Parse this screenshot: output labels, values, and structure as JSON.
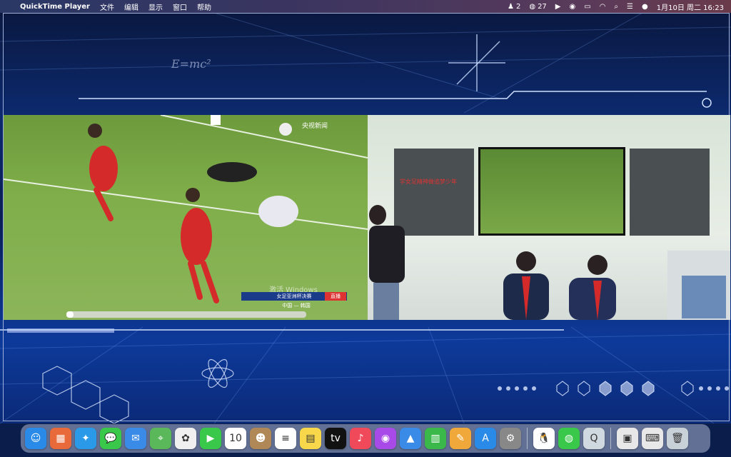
{
  "menubar": {
    "app_name": "QuickTime Player",
    "menus": [
      "文件",
      "编辑",
      "显示",
      "窗口",
      "帮助"
    ],
    "status": {
      "notifications_count": "2",
      "wechat_count": "27",
      "date_time": "1月10日 周二 16:23"
    }
  },
  "video": {
    "broadcaster_logo": "央视新闻",
    "watermark": "激活 Windows",
    "caption_title": "女足亚洲杯决赛",
    "caption_badge": "直播",
    "caption_sub": "中国 — 韩国",
    "progress_fraction": 0.03
  },
  "slide": {
    "formula": "E=mc²",
    "chalk_text": "学女足精神做追梦少年"
  },
  "dock": {
    "apps": [
      {
        "name": "finder",
        "glyph": "☺",
        "color": "#2a8ae8"
      },
      {
        "name": "launchpad",
        "glyph": "▦",
        "color": "#e86a3a"
      },
      {
        "name": "safari",
        "glyph": "✦",
        "color": "#2a9ae8"
      },
      {
        "name": "messages",
        "glyph": "💬",
        "color": "#3ac84a"
      },
      {
        "name": "mail",
        "glyph": "✉",
        "color": "#3a8ae8"
      },
      {
        "name": "maps",
        "glyph": "⌖",
        "color": "#5ab85a"
      },
      {
        "name": "photos",
        "glyph": "✿",
        "color": "#f0f0f0"
      },
      {
        "name": "facetime",
        "glyph": "▶",
        "color": "#3ac84a"
      },
      {
        "name": "calendar",
        "glyph": "10",
        "color": "#ffffff"
      },
      {
        "name": "contacts",
        "glyph": "☻",
        "color": "#b08858"
      },
      {
        "name": "reminders",
        "glyph": "≡",
        "color": "#ffffff"
      },
      {
        "name": "notes",
        "glyph": "▤",
        "color": "#f8d84a"
      },
      {
        "name": "apple-tv",
        "glyph": "tv",
        "color": "#111111"
      },
      {
        "name": "music",
        "glyph": "♪",
        "color": "#f04a5a"
      },
      {
        "name": "podcasts",
        "glyph": "◉",
        "color": "#a84ae8"
      },
      {
        "name": "keynote",
        "glyph": "▲",
        "color": "#3a8ae8"
      },
      {
        "name": "numbers",
        "glyph": "▥",
        "color": "#3ab84a"
      },
      {
        "name": "pages",
        "glyph": "✎",
        "color": "#f0a83a"
      },
      {
        "name": "app-store",
        "glyph": "A",
        "color": "#2a8ae8"
      },
      {
        "name": "system-preferences",
        "glyph": "⚙",
        "color": "#888888"
      },
      {
        "name": "qq",
        "glyph": "🐧",
        "color": "#ffffff"
      },
      {
        "name": "wechat",
        "glyph": "◍",
        "color": "#3ac84a"
      },
      {
        "name": "quicktime",
        "glyph": "Q",
        "color": "#d0d8e0"
      },
      {
        "name": "preview",
        "glyph": "▣",
        "color": "#e8e8e8"
      },
      {
        "name": "keyboard-viewer",
        "glyph": "⌨",
        "color": "#e8e8e8"
      },
      {
        "name": "trash",
        "glyph": "🗑",
        "color": "#c8d0d8"
      }
    ]
  }
}
